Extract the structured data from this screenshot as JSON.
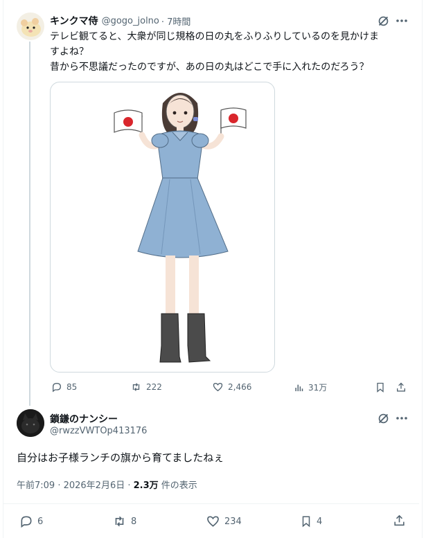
{
  "tweet": {
    "display_name": "キンクマ侍",
    "handle": "@gogo_jolno",
    "time": "· 7時間",
    "text_line1": "テレビ観てると、大衆が同じ規格の日の丸をふりふりしているのを見かけま",
    "text_line2": "すよね？",
    "text_line3": "昔から不思議だったのですが、あの日の丸はどこで手に入れたのだろう？",
    "stats": {
      "replies": "85",
      "reposts": "222",
      "likes": "2,466",
      "views": "31万"
    }
  },
  "reply": {
    "display_name": "鎖鎌のナンシー",
    "handle": "@rwzzVWTOp413176",
    "text": "自分はお子様ランチの旗から育てましたねぇ",
    "timestamp": "午前7:09 · 2026年2月6日 ·",
    "views_count": "2.3万",
    "views_label": "件の表示",
    "stats": {
      "replies": "6",
      "reposts": "8",
      "likes": "234",
      "bookmarks": "4"
    }
  },
  "colors": {
    "text": "#0f1419",
    "muted": "#536471",
    "border": "#cfd9de",
    "flag_red": "#d9262c",
    "dress": "#8fb1d3"
  },
  "icons": [
    "grok-icon",
    "more-icon",
    "reply-icon",
    "repost-icon",
    "like-icon",
    "views-icon",
    "bookmark-icon",
    "share-icon"
  ]
}
